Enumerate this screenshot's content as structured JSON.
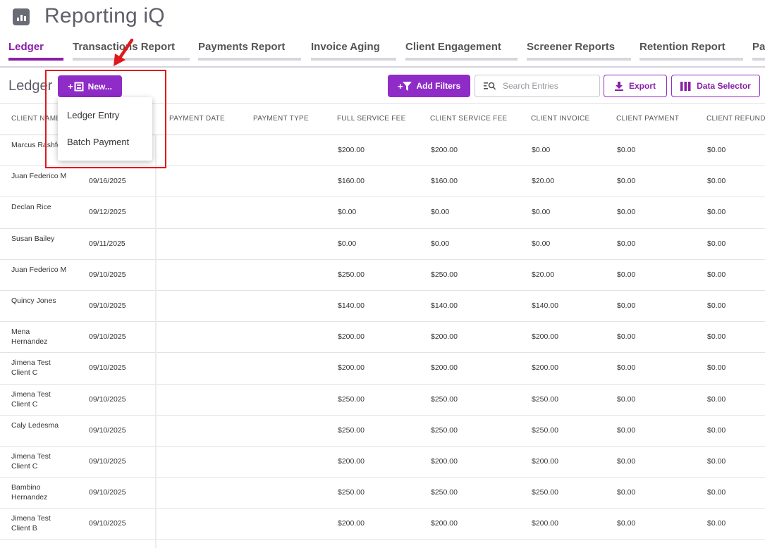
{
  "app": {
    "title": "Reporting iQ",
    "icon": "bar-chart-icon"
  },
  "tabs": [
    {
      "label": "Ledger",
      "active": true
    },
    {
      "label": "Transactions Report"
    },
    {
      "label": "Payments Report"
    },
    {
      "label": "Invoice Aging"
    },
    {
      "label": "Client Engagement"
    },
    {
      "label": "Screener Reports"
    },
    {
      "label": "Retention Report"
    },
    {
      "label": "Pa"
    }
  ],
  "toolbar": {
    "title": "Ledger",
    "new_label": "New...",
    "add_filters_label": "Add Filters",
    "search_placeholder": "Search Entries",
    "export_label": "Export",
    "data_selector_label": "Data Selector"
  },
  "new_menu": {
    "items": [
      "Ledger Entry",
      "Batch Payment"
    ]
  },
  "table": {
    "columns": [
      "CLIENT NAME",
      "PAYMENT DATE",
      "PAYMENT TYPE",
      "FULL SERVICE FEE",
      "CLIENT SERVICE FEE",
      "CLIENT INVOICE",
      "CLIENT PAYMENT",
      "CLIENT REFUND"
    ],
    "rows": [
      {
        "client": "Marcus Rashford",
        "date": "",
        "payment_date": "",
        "payment_type": "",
        "full_fee": "$200.00",
        "client_fee": "$200.00",
        "invoice": "$0.00",
        "payment": "$0.00",
        "refund": "$0.00"
      },
      {
        "client": "Juan Federico M",
        "date": "09/16/2025",
        "payment_date": "",
        "payment_type": "",
        "full_fee": "$160.00",
        "client_fee": "$160.00",
        "invoice": "$20.00",
        "payment": "$0.00",
        "refund": "$0.00"
      },
      {
        "client": "Declan Rice",
        "date": "09/12/2025",
        "payment_date": "",
        "payment_type": "",
        "full_fee": "$0.00",
        "client_fee": "$0.00",
        "invoice": "$0.00",
        "payment": "$0.00",
        "refund": "$0.00"
      },
      {
        "client": "Susan Bailey",
        "date": "09/11/2025",
        "payment_date": "",
        "payment_type": "",
        "full_fee": "$0.00",
        "client_fee": "$0.00",
        "invoice": "$0.00",
        "payment": "$0.00",
        "refund": "$0.00"
      },
      {
        "client": "Juan Federico M",
        "date": "09/10/2025",
        "payment_date": "",
        "payment_type": "",
        "full_fee": "$250.00",
        "client_fee": "$250.00",
        "invoice": "$20.00",
        "payment": "$0.00",
        "refund": "$0.00"
      },
      {
        "client": "Quincy Jones",
        "date": "09/10/2025",
        "payment_date": "",
        "payment_type": "",
        "full_fee": "$140.00",
        "client_fee": "$140.00",
        "invoice": "$140.00",
        "payment": "$0.00",
        "refund": "$0.00"
      },
      {
        "client": "Mena Hernandez",
        "date": "09/10/2025",
        "payment_date": "",
        "payment_type": "",
        "full_fee": "$200.00",
        "client_fee": "$200.00",
        "invoice": "$200.00",
        "payment": "$0.00",
        "refund": "$0.00"
      },
      {
        "client": "Jimena Test Client C",
        "date": "09/10/2025",
        "payment_date": "",
        "payment_type": "",
        "full_fee": "$200.00",
        "client_fee": "$200.00",
        "invoice": "$200.00",
        "payment": "$0.00",
        "refund": "$0.00"
      },
      {
        "client": "Jimena Test Client C",
        "date": "09/10/2025",
        "payment_date": "",
        "payment_type": "",
        "full_fee": "$250.00",
        "client_fee": "$250.00",
        "invoice": "$250.00",
        "payment": "$0.00",
        "refund": "$0.00"
      },
      {
        "client": "Caly Ledesma",
        "date": "09/10/2025",
        "payment_date": "",
        "payment_type": "",
        "full_fee": "$250.00",
        "client_fee": "$250.00",
        "invoice": "$250.00",
        "payment": "$0.00",
        "refund": "$0.00"
      },
      {
        "client": "Jimena Test Client C",
        "date": "09/10/2025",
        "payment_date": "",
        "payment_type": "",
        "full_fee": "$200.00",
        "client_fee": "$200.00",
        "invoice": "$200.00",
        "payment": "$0.00",
        "refund": "$0.00"
      },
      {
        "client": "Bambino Hernandez",
        "date": "09/10/2025",
        "payment_date": "",
        "payment_type": "",
        "full_fee": "$250.00",
        "client_fee": "$250.00",
        "invoice": "$250.00",
        "payment": "$0.00",
        "refund": "$0.00"
      },
      {
        "client": "Jimena Test Client B",
        "date": "09/10/2025",
        "payment_date": "",
        "payment_type": "",
        "full_fee": "$200.00",
        "client_fee": "$200.00",
        "invoice": "$200.00",
        "payment": "$0.00",
        "refund": "$0.00"
      }
    ]
  },
  "colors": {
    "accent": "#8f2bc7",
    "accent_text": "#8a1ea8",
    "annotation": "#e0191c"
  }
}
